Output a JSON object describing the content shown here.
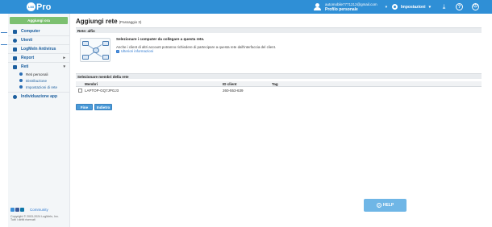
{
  "app": {
    "logo_mark": "LMI",
    "logo_text": "Pro"
  },
  "topbar": {
    "user_email": "automobile7771212@gmail.com",
    "user_profile": "Profilo personale",
    "settings_label": "Impostazioni",
    "icons": [
      "user-icon",
      "gear-icon",
      "download-icon",
      "help-icon",
      "power-icon"
    ]
  },
  "sidebar": {
    "add_button": "Aggiungi ora",
    "items": [
      {
        "label": "Computer",
        "icon": "monitor-icon"
      },
      {
        "label": "Utenti",
        "icon": "user-icon"
      },
      {
        "label": "LogMeIn Antivirus",
        "icon": "shield-icon"
      },
      {
        "label": "Report",
        "icon": "chart-icon"
      },
      {
        "label": "Reti",
        "icon": "network-icon"
      },
      {
        "label": "Reti personali",
        "icon": "network-icon"
      },
      {
        "label": "Distribuzione",
        "icon": "deploy-icon"
      },
      {
        "label": "Impostazioni di rete",
        "icon": "settings-icon"
      },
      {
        "label": "Individuazione app",
        "icon": "search-icon"
      }
    ],
    "community_label": "Community",
    "copyright": "Copyright © 2003-2024 LogMeIn, Inc.",
    "rights": "Tutti i diritti riservati"
  },
  "main": {
    "title": "Aggiungi rete",
    "step": "(Passaggio 3)",
    "network_label": "Rete: alfio",
    "select_title": "Selezionare i computer da collegare a questa rete.",
    "select_desc": "Anche i client di altri account potranno richiedere di partecipare a questa rete dall'interfaccia del client.",
    "more_info": "Ulteriori informazioni",
    "members_section": "Selezionare membri della rete",
    "table": {
      "headers": [
        "Membri",
        "ID client",
        "Tag"
      ],
      "rows": [
        {
          "member": "LAPTOP-GQ7JPGJ3",
          "client_id": "260-553-639",
          "tag": ""
        }
      ]
    },
    "buttons": {
      "finish": "Fine",
      "back": "Indietro"
    }
  },
  "help": {
    "label": "HELP"
  },
  "colors": {
    "topbar": "#2f8fd6",
    "add_button": "#7cc070",
    "link": "#2f7ad1",
    "primary_button": "#4a9ad8"
  }
}
